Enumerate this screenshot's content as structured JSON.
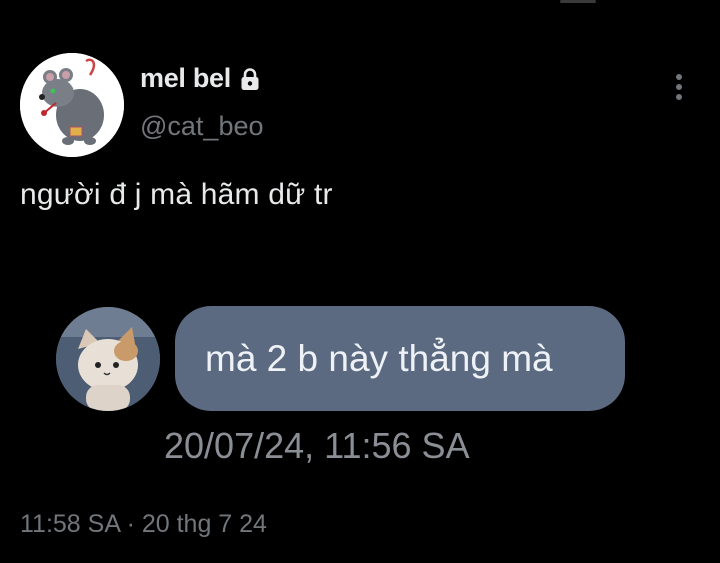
{
  "tweet": {
    "author": {
      "display_name": "mel bel",
      "handle": "@cat_beo",
      "protected_icon": "lock-icon",
      "avatar_icon": "rat-plush-avatar"
    },
    "text": "người đ j mà hãm dữ tr",
    "more_icon": "more-vertical-icon",
    "media": {
      "chat_avatar_icon": "cat-avatar",
      "message": "mà 2 b này thẳng mà",
      "message_time": "20/07/24, 11:56 SA",
      "bubble_color": "#5b6a80"
    },
    "timestamp": "11:58 SA · 20 thg 7 24"
  },
  "colors": {
    "background": "#000000",
    "primary_text": "#e7e9ea",
    "secondary_text": "#71767b"
  }
}
